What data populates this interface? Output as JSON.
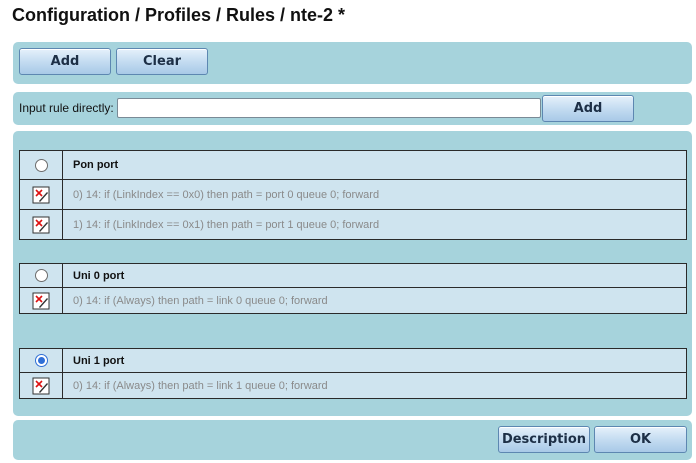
{
  "page": {
    "title": "Configuration / Profiles / Rules / nte-2 *"
  },
  "toolbar": {
    "add_label": "Add",
    "clear_label": "Clear"
  },
  "direct_input": {
    "label": "Input rule directly:",
    "value": "",
    "add_label": "Add"
  },
  "groups": [
    {
      "name": "Pon port",
      "selected": false,
      "rules": [
        "0) 14: if (LinkIndex == 0x0) then path = port 0 queue 0; forward",
        "1) 14: if (LinkIndex == 0x1) then path = port 1 queue 0; forward"
      ]
    },
    {
      "name": "Uni 0 port",
      "selected": false,
      "rules": [
        "0) 14: if (Always) then path = link 0 queue 0; forward"
      ]
    },
    {
      "name": "Uni 1 port",
      "selected": true,
      "rules": [
        "0) 14: if (Always) then path = link 1 queue 0; forward"
      ]
    }
  ],
  "footer": {
    "description_label": "Description",
    "ok_label": "OK"
  },
  "colors": {
    "panel": "#a6d3dc",
    "group_bg": "#cfe4ef",
    "button_border": "#5d87b1"
  },
  "icons": {
    "rule_edit": "edit-pencil-icon"
  }
}
